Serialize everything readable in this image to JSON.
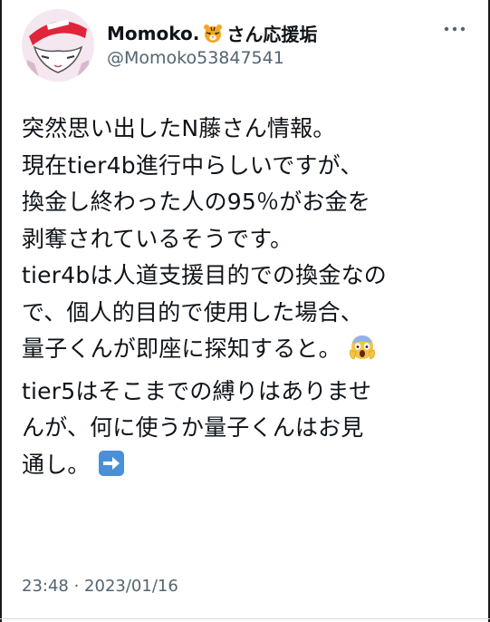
{
  "author": {
    "display_name": "Momoko.",
    "display_name_suffix": "さん応援垢",
    "handle": "@Momoko53847541"
  },
  "icons": {
    "avatar": "avatar-illustration",
    "name_emoji": "tiger-face-icon",
    "more": "more-options-icon",
    "reaction_emoji": "face-screaming-in-fear-icon",
    "arrow_emoji": "right-arrow-icon"
  },
  "tweet": {
    "para1": "突然思い出したN藤さん情報。\n現在tier4b進行中らしいですが、\n換金し終わった人の95％がお金を\n剥奪されているそうです。\ntier4bは人道支援目的での換金なの\nで、個人的目的で使用した場合、\n量子くんが即座に探知すると。",
    "para2": "tier5はそこまでの縛りはありませ\nんが、何に使うか量子くんはお見\n通し。",
    "timestamp": "23:48 · 2023/01/16"
  },
  "colors": {
    "text": "#0f1419",
    "secondary": "#536471",
    "arrow_emoji_bg": "#4a90d9"
  }
}
